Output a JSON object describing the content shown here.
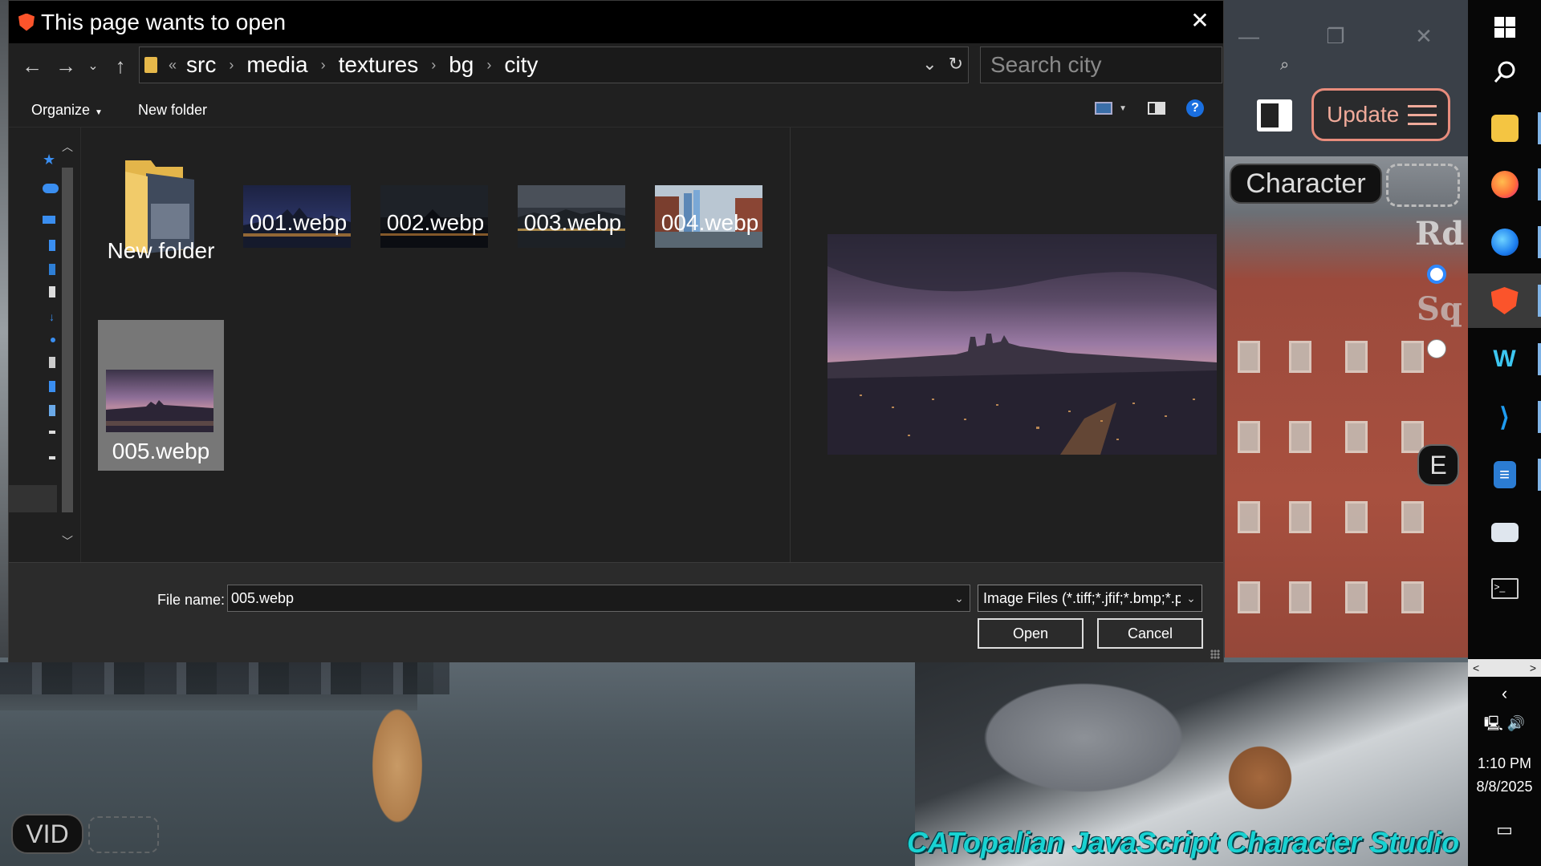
{
  "dialog": {
    "title": "This page wants to open",
    "breadcrumb_overflow": "«",
    "breadcrumb": [
      "src",
      "media",
      "textures",
      "bg",
      "city"
    ],
    "search_placeholder": "Search city",
    "toolbar": {
      "organize": "Organize",
      "new_folder": "New folder"
    },
    "files": [
      {
        "name": "New folder",
        "type": "folder"
      },
      {
        "name": "001.webp",
        "type": "image"
      },
      {
        "name": "002.webp",
        "type": "image"
      },
      {
        "name": "003.webp",
        "type": "image"
      },
      {
        "name": "004.webp",
        "type": "image"
      },
      {
        "name": "005.webp",
        "type": "image",
        "selected": true
      }
    ],
    "file_name_label": "File name:",
    "file_name_value": "005.webp",
    "file_type": "Image Files (*.tiff;*.jfif;*.bmp;*.p",
    "open_button": "Open",
    "cancel_button": "Cancel"
  },
  "app": {
    "update_button": "Update",
    "character_button": "Character",
    "rd_label": "Rd",
    "sq_label": "Sq",
    "e_button": "E",
    "vid_button": "VID",
    "studio_title": "CATopalian JavaScript Character Studio"
  },
  "taskbar": {
    "items": [
      "windows-icon",
      "search-icon",
      "file-explorer-icon",
      "firefox-icon",
      "firefox-dev-icon",
      "brave-icon",
      "windsurf-icon",
      "vscode-icon",
      "docs-icon",
      "monitor-icon",
      "terminal-icon"
    ],
    "time": "1:10 PM",
    "date": "8/8/2025"
  },
  "colors": {
    "accent_blue": "#1a6fe0",
    "update_border": "#e88c7c",
    "studio_text": "#19d2d2",
    "brave": "#fb542b"
  }
}
